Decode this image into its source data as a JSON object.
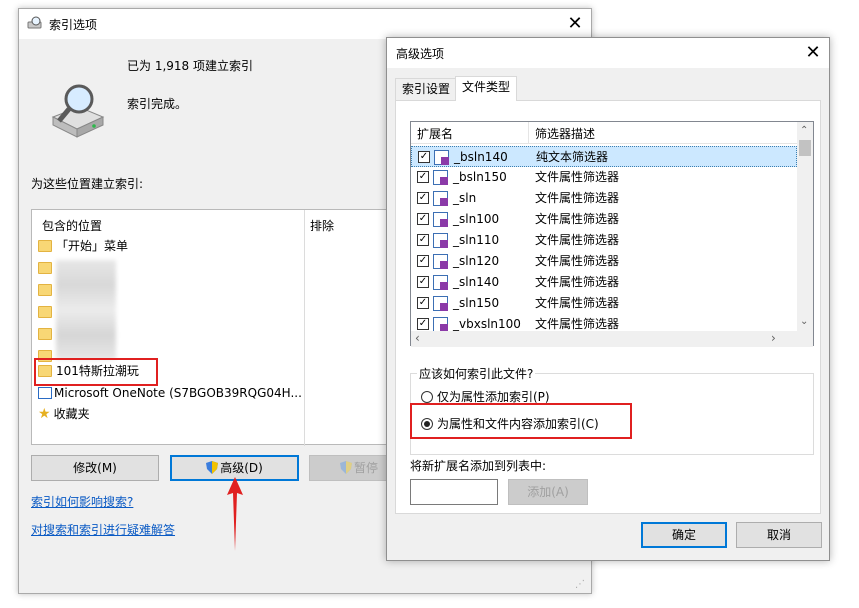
{
  "main_window": {
    "title": "索引选项",
    "close_glyph": "✕",
    "status_count": "已为 1,918 项建立索引",
    "status_done": "索引完成。",
    "locations_label": "为这些位置建立索引:",
    "col_included": "包含的位置",
    "col_excluded": "排除",
    "locations": [
      {
        "label": "「开始」菜单",
        "icon": "folder-icon"
      },
      {
        "label": "101特斯拉潮玩",
        "icon": "folder-icon"
      },
      {
        "label": "Microsoft OneNote (S7BGOB39RQG04H...",
        "icon": "onenote-icon"
      },
      {
        "label": "收藏夹",
        "icon": "star-icon"
      }
    ],
    "buttons": {
      "modify": "修改(M)",
      "advanced": "高级(D)",
      "pause": "暂停"
    },
    "links": {
      "how_affects": "索引如何影响搜索?",
      "troubleshoot": "对搜索和索引进行疑难解答"
    }
  },
  "advanced_window": {
    "title": "高级选项",
    "close_glyph": "✕",
    "tabs": [
      "索引设置",
      "文件类型"
    ],
    "active_tab": "文件类型",
    "col_ext": "扩展名",
    "col_filter": "筛选器描述",
    "file_types": [
      {
        "ext": "_bsln140",
        "filter": "纯文本筛选器",
        "selected": true
      },
      {
        "ext": "_bsln150",
        "filter": "文件属性筛选器"
      },
      {
        "ext": "_sln",
        "filter": "文件属性筛选器"
      },
      {
        "ext": "_sln100",
        "filter": "文件属性筛选器"
      },
      {
        "ext": "_sln110",
        "filter": "文件属性筛选器"
      },
      {
        "ext": "_sln120",
        "filter": "文件属性筛选器"
      },
      {
        "ext": "_sln140",
        "filter": "文件属性筛选器"
      },
      {
        "ext": "_sln150",
        "filter": "文件属性筛选器"
      },
      {
        "ext": "_vbxsln100",
        "filter": "文件属性筛选器"
      }
    ],
    "how_index_label": "应该如何索引此文件?",
    "radio_props_only": "仅为属性添加索引(P)",
    "radio_props_content": "为属性和文件内容添加索引(C)",
    "add_ext_label": "将新扩展名添加到列表中:",
    "add_ext_value": "",
    "add_button": "添加(A)",
    "ok_button": "确定",
    "cancel_button": "取消"
  },
  "colors": {
    "highlight_red": "#e02020",
    "link_blue": "#0a5ac4",
    "selection": "#cce8ff"
  }
}
